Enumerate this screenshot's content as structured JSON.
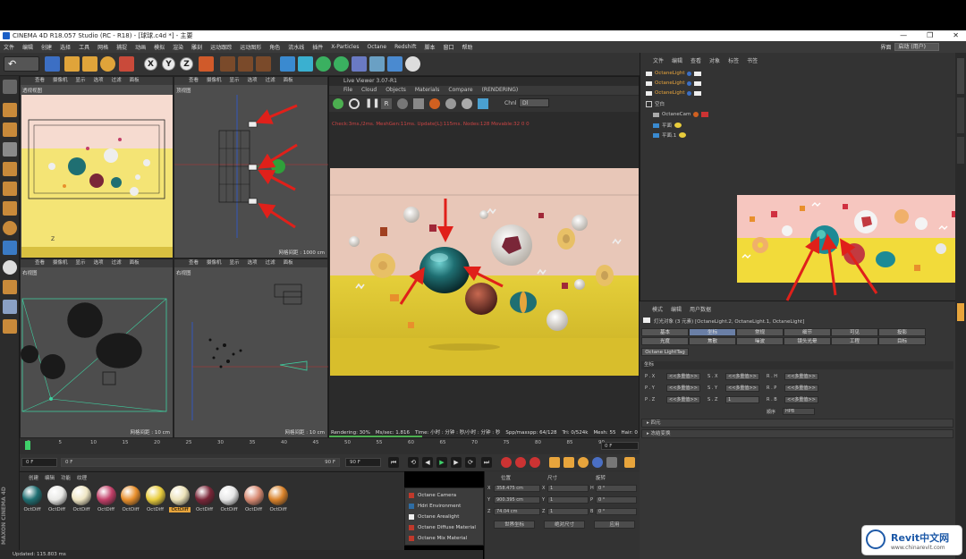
{
  "window": {
    "title": "CINEMA 4D R18.057 Studio (RC - R18) - [球球.c4d *] - 主要",
    "controls": [
      "—",
      "❐",
      "✕"
    ]
  },
  "menubar": {
    "items": [
      "文件",
      "编辑",
      "创建",
      "选择",
      "工具",
      "网格",
      "捕捉",
      "动画",
      "模拟",
      "渲染",
      "雕刻",
      "运动跟踪",
      "运动图形",
      "角色",
      "流水线",
      "插件",
      "X-Particles",
      "Octane",
      "Redshift",
      "脚本",
      "窗口",
      "帮助"
    ],
    "layout_label": "界面",
    "layout_value": "启动 (用户)"
  },
  "viewports": {
    "menu": [
      "查看",
      "摄像机",
      "显示",
      "选项",
      "过滤",
      "面板"
    ],
    "perspective": {
      "title": "透视视图",
      "axis": "Z"
    },
    "top": {
      "title": "顶视图",
      "footer": "网格间距 : 1000 cm"
    },
    "right": {
      "title": "右视图",
      "footer": ""
    },
    "front": {
      "title": "正视图",
      "footer": "网格间距 : 10 cm"
    },
    "side_footer": "网格间距 : 10 cm"
  },
  "live_viewer": {
    "title": "Live Viewer 3.07-R1",
    "menu": [
      "File",
      "Cloud",
      "Objects",
      "Materials",
      "Compare",
      "(RENDERING)"
    ],
    "channel_label": "Chnl",
    "channel_value": "Dl",
    "status": "Check:3ms./2ms. MeshGen:11ms. Update[L]:115ms. Nodes:128 Movable:32  0 0",
    "bottom": {
      "rendering": "Rendering: 30%",
      "ms_sec": "Ms/sec: 1.816",
      "time": "Time: 小时 : 分钟 : 秒/小时 : 分钟 : 秒",
      "spp": "Spp/maxspp: 64/128",
      "tri": "Tri: 0/524k",
      "mesh": "Mesh: 55",
      "hair": "Hair: 0"
    }
  },
  "object_manager": {
    "menu": [
      "文件",
      "编辑",
      "查看",
      "对象",
      "标签",
      "书签"
    ],
    "items": [
      {
        "name": "OctaneLight",
        "highlight": true
      },
      {
        "name": "OctaneLight",
        "highlight": true
      },
      {
        "name": "OctaneLight",
        "highlight": true
      },
      {
        "name": "空白",
        "highlight": false
      },
      {
        "name": "OctaneCam",
        "highlight": false
      },
      {
        "name": "平面",
        "highlight": false
      },
      {
        "name": "平面.1",
        "highlight": false
      }
    ]
  },
  "attributes": {
    "menu": [
      "模式",
      "编辑",
      "用户数据"
    ],
    "object_line": "灯光对象 (3 元素) [OctaneLight.2, OctaneLight.1, OctaneLight]",
    "tabs_row1": [
      "基本",
      "坐标",
      "常规",
      "细节",
      "可见",
      "投影"
    ],
    "tabs_row2": [
      "光度",
      "焦散",
      "噪波",
      "镜头光晕",
      "工程",
      "目标"
    ],
    "tag_tab": "Octane LightTag",
    "coord_section": "坐标",
    "rows": [
      {
        "p": "P . X",
        "pv": "<<多重值>>",
        "s": "S . X",
        "sv": "<<多重值>>",
        "r": "R . H",
        "rv": "<<多重值>>"
      },
      {
        "p": "P . Y",
        "pv": "<<多重值>>",
        "s": "S . Y",
        "sv": "<<多重值>>",
        "r": "R . P",
        "rv": "<<多重值>>"
      },
      {
        "p": "P . Z",
        "pv": "<<多重值>>",
        "s": "S . Z",
        "sv": "1",
        "r": "R . B",
        "rv": "<<多重值>>"
      }
    ],
    "order_label": "顺序",
    "order_value": "HPB",
    "sections": [
      "▸ 四元",
      "▸ 冻结变换"
    ]
  },
  "timeline": {
    "ticks": [
      "0",
      "5",
      "10",
      "15",
      "20",
      "25",
      "30",
      "35",
      "40",
      "45",
      "50",
      "55",
      "60",
      "65",
      "70",
      "75",
      "80",
      "85",
      "90"
    ],
    "current_frame": "0 F",
    "start": "0 F",
    "end_field": "90 F",
    "max": "90 F",
    "frame_field": "0 F"
  },
  "material_manager": {
    "menu": [
      "创建",
      "编辑",
      "功能",
      "纹理"
    ],
    "materials": [
      {
        "label": "OctDiff",
        "color": "#1f6f72",
        "selected": false
      },
      {
        "label": "OctDiff",
        "color": "#e9e9e6",
        "selected": false
      },
      {
        "label": "OctDiff",
        "color": "#efe6c4",
        "selected": false
      },
      {
        "label": "OctDiff",
        "color": "#c23f68",
        "selected": false
      },
      {
        "label": "OctDiff",
        "color": "#e88f2c",
        "selected": false
      },
      {
        "label": "OctDiff",
        "color": "#e8cc3c",
        "selected": false
      },
      {
        "label": "OctDiff",
        "color": "#ece2b8",
        "selected": true
      },
      {
        "label": "OctDiff",
        "color": "#7a2638",
        "selected": false
      },
      {
        "label": "OctDiff",
        "color": "#e6e6e6",
        "selected": false
      },
      {
        "label": "OctDiff",
        "color": "#d88a72",
        "selected": false
      },
      {
        "label": "OctDiff",
        "color": "#d9822a",
        "selected": false
      }
    ]
  },
  "popup_menu": {
    "items": [
      {
        "label": "Octane Camera",
        "color": "#c0392b"
      },
      {
        "label": "Hdri Environment",
        "color": "#2e6da4"
      },
      {
        "label": "Octane Arealight",
        "color": "#eeeeee"
      },
      {
        "label": "Octane Diffuse Material",
        "color": "#c0392b"
      },
      {
        "label": "Octane Mix Material",
        "color": "#c0392b"
      }
    ]
  },
  "coordinates": {
    "headers": [
      "位置",
      "尺寸",
      "旋转"
    ],
    "rows": [
      {
        "axis": "X",
        "pos": "358.475 cm",
        "size": "1",
        "rot_label": "H",
        "rot": "0 °"
      },
      {
        "axis": "Y",
        "pos": "900.395 cm",
        "size": "1",
        "rot_label": "P",
        "rot": "0 °"
      },
      {
        "axis": "Z",
        "pos": "74.04 cm",
        "size": "1",
        "rot_label": "B",
        "rot": "0 °"
      }
    ],
    "mode_button": "世界坐标",
    "scale_button": "绝对尺寸",
    "apply_button": "应用"
  },
  "statusbar": {
    "text": "Updated: 115.803 ms"
  },
  "branding": {
    "vertical": "MAXON CINEMA 4D"
  },
  "watermark": {
    "brand": "Revit中文网",
    "url": "www.chinarevit.com"
  },
  "colors": {
    "accent_orange": "#e8a53c",
    "arrow_red": "#e0201a",
    "render_wall": "#e8c7b8",
    "render_floor": "#e3c935"
  }
}
